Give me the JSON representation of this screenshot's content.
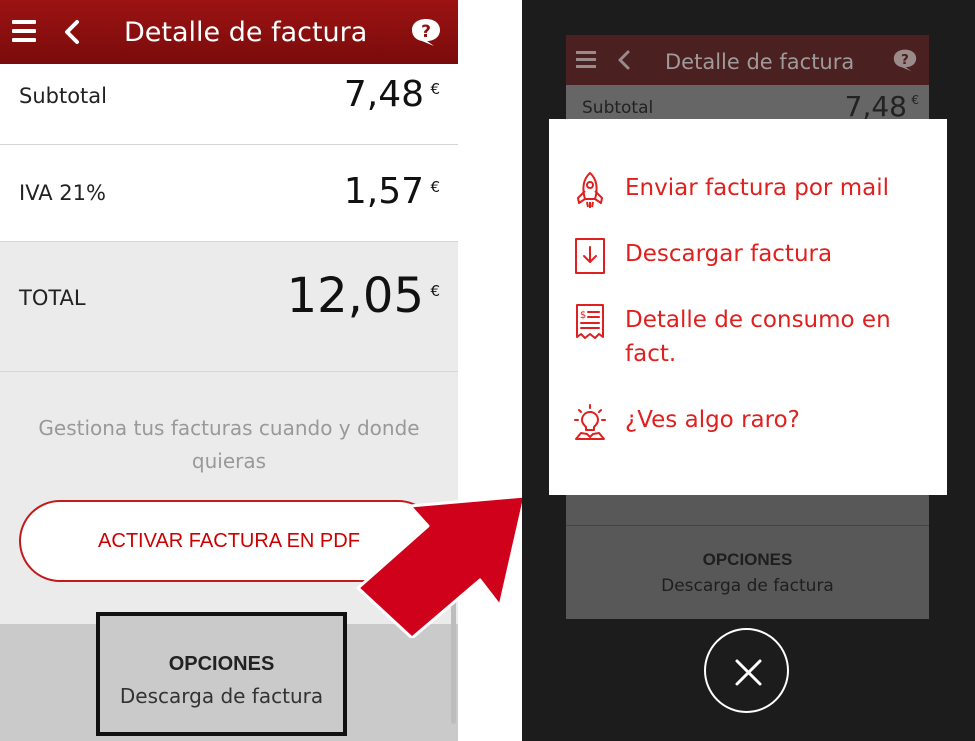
{
  "left": {
    "header": {
      "title": "Detalle de factura"
    },
    "rows": {
      "subtotal": {
        "label": "Subtotal",
        "value": "7,48",
        "currency": "€"
      },
      "iva": {
        "label": "IVA 21%",
        "value": "1,57",
        "currency": "€"
      },
      "total": {
        "label": "TOTAL",
        "value": "12,05",
        "currency": "€"
      }
    },
    "promo_text": "Gestiona tus facturas cuando y donde quieras",
    "pdf_button_label": "ACTIVAR FACTURA EN PDF",
    "options": {
      "title": "OPCIONES",
      "subtitle": "Descarga de factura"
    }
  },
  "right": {
    "header": {
      "title": "Detalle de factura"
    },
    "subtotal": {
      "label": "Subtotal",
      "value": "7,48",
      "currency": "€"
    },
    "options": {
      "title": "OPCIONES",
      "subtitle": "Descarga de factura"
    },
    "menu": [
      {
        "label": "Enviar factura por mail",
        "icon": "rocket-icon"
      },
      {
        "label": "Descargar factura",
        "icon": "download-document-icon"
      },
      {
        "label": "Detalle de consumo en fact.",
        "icon": "receipt-icon"
      },
      {
        "label": "¿Ves algo raro?",
        "icon": "lightbulb-icon"
      }
    ]
  },
  "colors": {
    "brand_red": "#e0201f",
    "header_red": "#8d1010",
    "arrow_red": "#d0021b"
  }
}
